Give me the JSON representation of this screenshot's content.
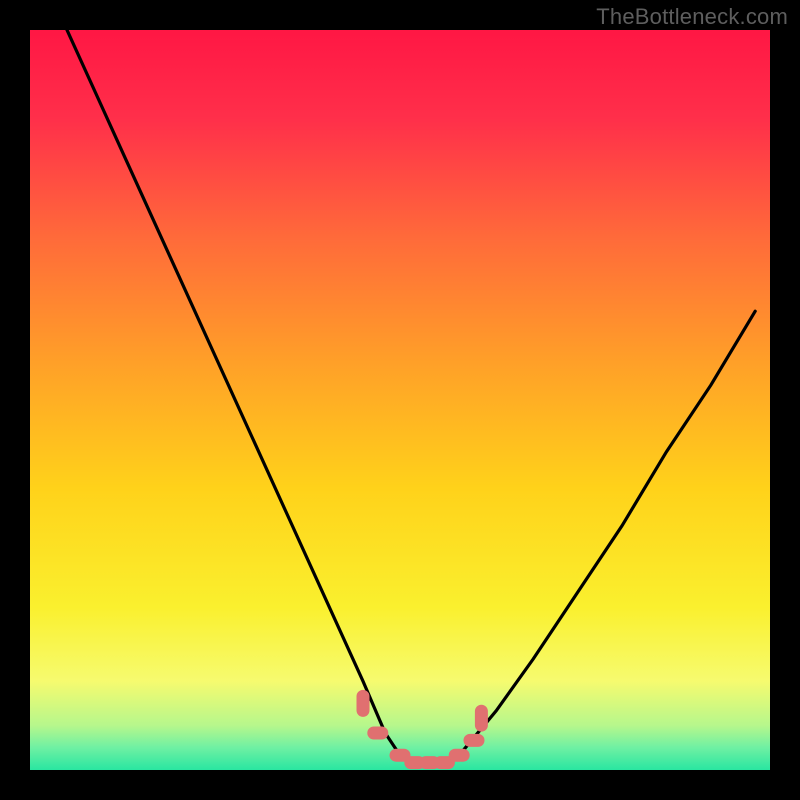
{
  "watermark": "TheBottleneck.com",
  "chart_data": {
    "type": "line",
    "title": "",
    "xlabel": "",
    "ylabel": "",
    "xlim": [
      0,
      100
    ],
    "ylim": [
      0,
      100
    ],
    "grid": false,
    "legend": false,
    "series": [
      {
        "name": "bottleneck-curve",
        "x": [
          5,
          10,
          15,
          20,
          25,
          30,
          35,
          40,
          45,
          48,
          50,
          53,
          56,
          58,
          63,
          68,
          74,
          80,
          86,
          92,
          98
        ],
        "values": [
          100,
          89,
          78,
          67,
          56,
          45,
          34,
          23,
          12,
          5,
          2,
          1,
          1,
          2,
          8,
          15,
          24,
          33,
          43,
          52,
          62
        ]
      }
    ],
    "gradient_stops": [
      {
        "offset": 0.0,
        "color": "#ff1744"
      },
      {
        "offset": 0.12,
        "color": "#ff2f4a"
      },
      {
        "offset": 0.28,
        "color": "#ff6a3a"
      },
      {
        "offset": 0.45,
        "color": "#ffa028"
      },
      {
        "offset": 0.62,
        "color": "#ffd21a"
      },
      {
        "offset": 0.78,
        "color": "#faf02e"
      },
      {
        "offset": 0.88,
        "color": "#f6fb6f"
      },
      {
        "offset": 0.94,
        "color": "#b6f78c"
      },
      {
        "offset": 0.97,
        "color": "#6ef0a3"
      },
      {
        "offset": 1.0,
        "color": "#29e6a1"
      }
    ],
    "markers": {
      "name": "optimal-zone",
      "color": "#e07070",
      "points": [
        {
          "x": 45,
          "y": 9
        },
        {
          "x": 47,
          "y": 5
        },
        {
          "x": 50,
          "y": 2
        },
        {
          "x": 52,
          "y": 1
        },
        {
          "x": 54,
          "y": 1
        },
        {
          "x": 56,
          "y": 1
        },
        {
          "x": 58,
          "y": 2
        },
        {
          "x": 60,
          "y": 4
        },
        {
          "x": 61,
          "y": 7
        }
      ]
    }
  }
}
